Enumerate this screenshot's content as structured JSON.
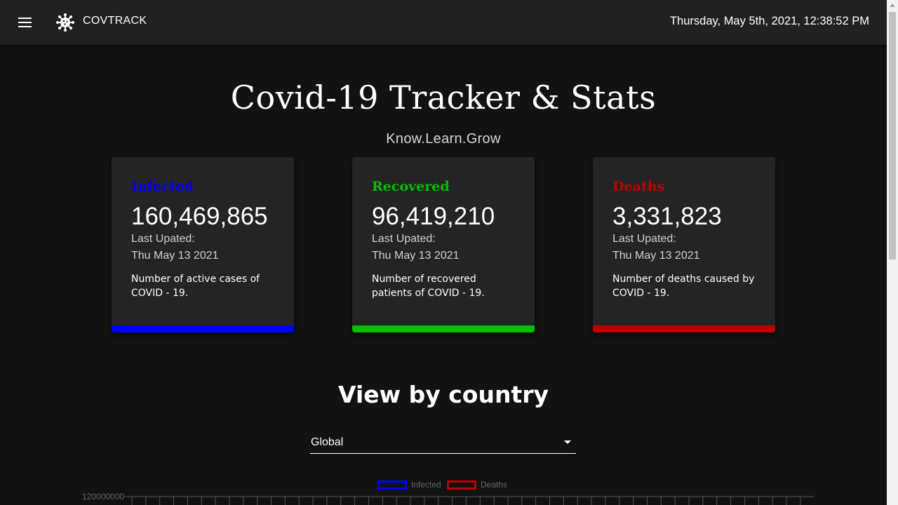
{
  "header": {
    "brand": "COVTRACK",
    "datetime": "Thursday, May 5th, 2021, 12:38:52 PM"
  },
  "hero": {
    "title": "Covid-19 Tracker & Stats",
    "subtitle": "Know.Learn.Grow"
  },
  "cards": [
    {
      "title": "Infected",
      "value": "160,469,865",
      "updated_label": "Last Upated:",
      "date": "Thu May 13 2021",
      "description": "Number of active cases of COVID - 19.",
      "color": "#0000ff"
    },
    {
      "title": "Recovered",
      "value": "96,419,210",
      "updated_label": "Last Upated:",
      "date": "Thu May 13 2021",
      "description": "Number of recovered patients of COVID - 19.",
      "color": "#00c000"
    },
    {
      "title": "Deaths",
      "value": "3,331,823",
      "updated_label": "Last Upated:",
      "date": "Thu May 13 2021",
      "description": "Number of deaths caused by COVID - 19.",
      "color": "#c00000"
    }
  ],
  "country_section": {
    "title": "View by country",
    "selected": "Global"
  },
  "chart": {
    "legend": [
      {
        "label": "Infected",
        "color": "#0000ff"
      },
      {
        "label": "Deaths",
        "color": "#c00000"
      }
    ],
    "y_tick_top": "120000000"
  },
  "icons": {
    "menu": "menu-icon",
    "logo": "virus-icon",
    "dropdown": "caret-down-icon"
  }
}
